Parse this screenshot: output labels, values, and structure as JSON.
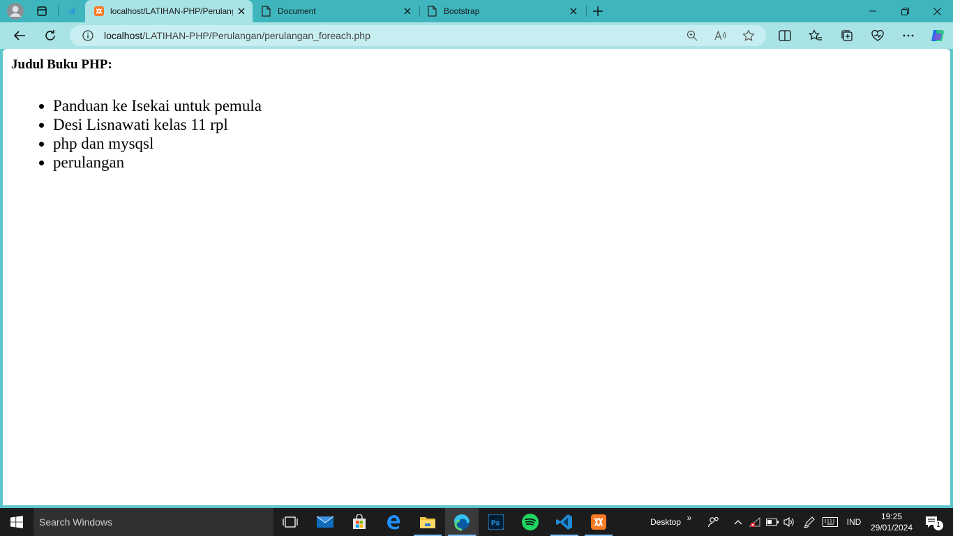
{
  "browser": {
    "tabs": [
      {
        "title": "localhost/LATIHAN-PHP/Perulangan/perulangan_foreach.php",
        "active": true,
        "icon": "xampp-icon"
      },
      {
        "title": "Document",
        "active": false,
        "icon": "page-icon"
      },
      {
        "title": "Bootstrap",
        "active": false,
        "icon": "page-icon"
      }
    ],
    "url_host": "localhost",
    "url_path": "/LATIHAN-PHP/Perulangan/perulangan_foreach.php"
  },
  "page": {
    "heading": "Judul Buku PHP:",
    "items": [
      "Panduan ke Isekai untuk pemula",
      "Desi Lisnawati kelas 11 rpl",
      "php dan mysqsl",
      "perulangan"
    ]
  },
  "taskbar": {
    "search_placeholder": "Search Windows",
    "desktop_label": "Desktop",
    "language": "IND",
    "time": "19:25",
    "date": "29/01/2024",
    "notification_count": "1"
  },
  "colors": {
    "tab_strip": "#3fb6bd",
    "toolbar": "#a9e3e6",
    "taskbar": "#1c1c1c"
  }
}
